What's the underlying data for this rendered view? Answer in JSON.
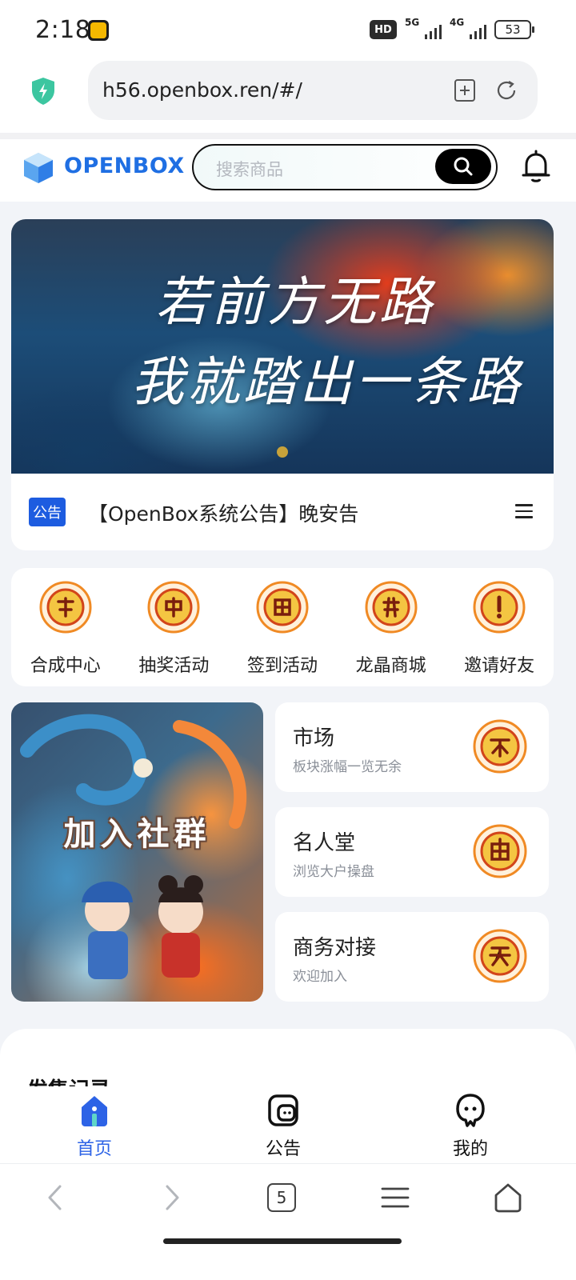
{
  "status_bar": {
    "time": "2:18",
    "hd_label": "HD",
    "network_1": "5G",
    "network_2": "4G",
    "battery": "53"
  },
  "browser": {
    "url": "h56.openbox.ren/#/",
    "tab_count": "5"
  },
  "header": {
    "logo_text": "OPENBOX",
    "search_placeholder": "搜索商品"
  },
  "banner": {
    "line1": "若前方无路",
    "line2": "我就踏出一条路"
  },
  "notice": {
    "tag": "公告",
    "text": "【OpenBox系统公告】晚安告"
  },
  "quick_entries": [
    {
      "label": "合成中心",
      "icon": "fire-seal-icon"
    },
    {
      "label": "抽奖活动",
      "icon": "fire-seal-icon"
    },
    {
      "label": "签到活动",
      "icon": "fire-seal-icon"
    },
    {
      "label": "龙晶商城",
      "icon": "fire-seal-icon"
    },
    {
      "label": "邀请好友",
      "icon": "fire-seal-icon"
    }
  ],
  "community": {
    "title": "加入社群"
  },
  "side_cards": [
    {
      "title": "市场",
      "subtitle": "板块涨幅一览无余"
    },
    {
      "title": "名人堂",
      "subtitle": "浏览大户操盘"
    },
    {
      "title": "商务对接",
      "subtitle": "欢迎加入"
    }
  ],
  "records": {
    "title": "发售记录"
  },
  "tabs": [
    {
      "label": "首页",
      "icon": "home-icon",
      "active": true
    },
    {
      "label": "公告",
      "icon": "notice-icon",
      "active": false
    },
    {
      "label": "我的",
      "icon": "profile-icon",
      "active": false
    }
  ],
  "colors": {
    "accent": "#2d63e6",
    "notice_tag": "#1d5ce0",
    "logo": "#1f6fe3"
  }
}
